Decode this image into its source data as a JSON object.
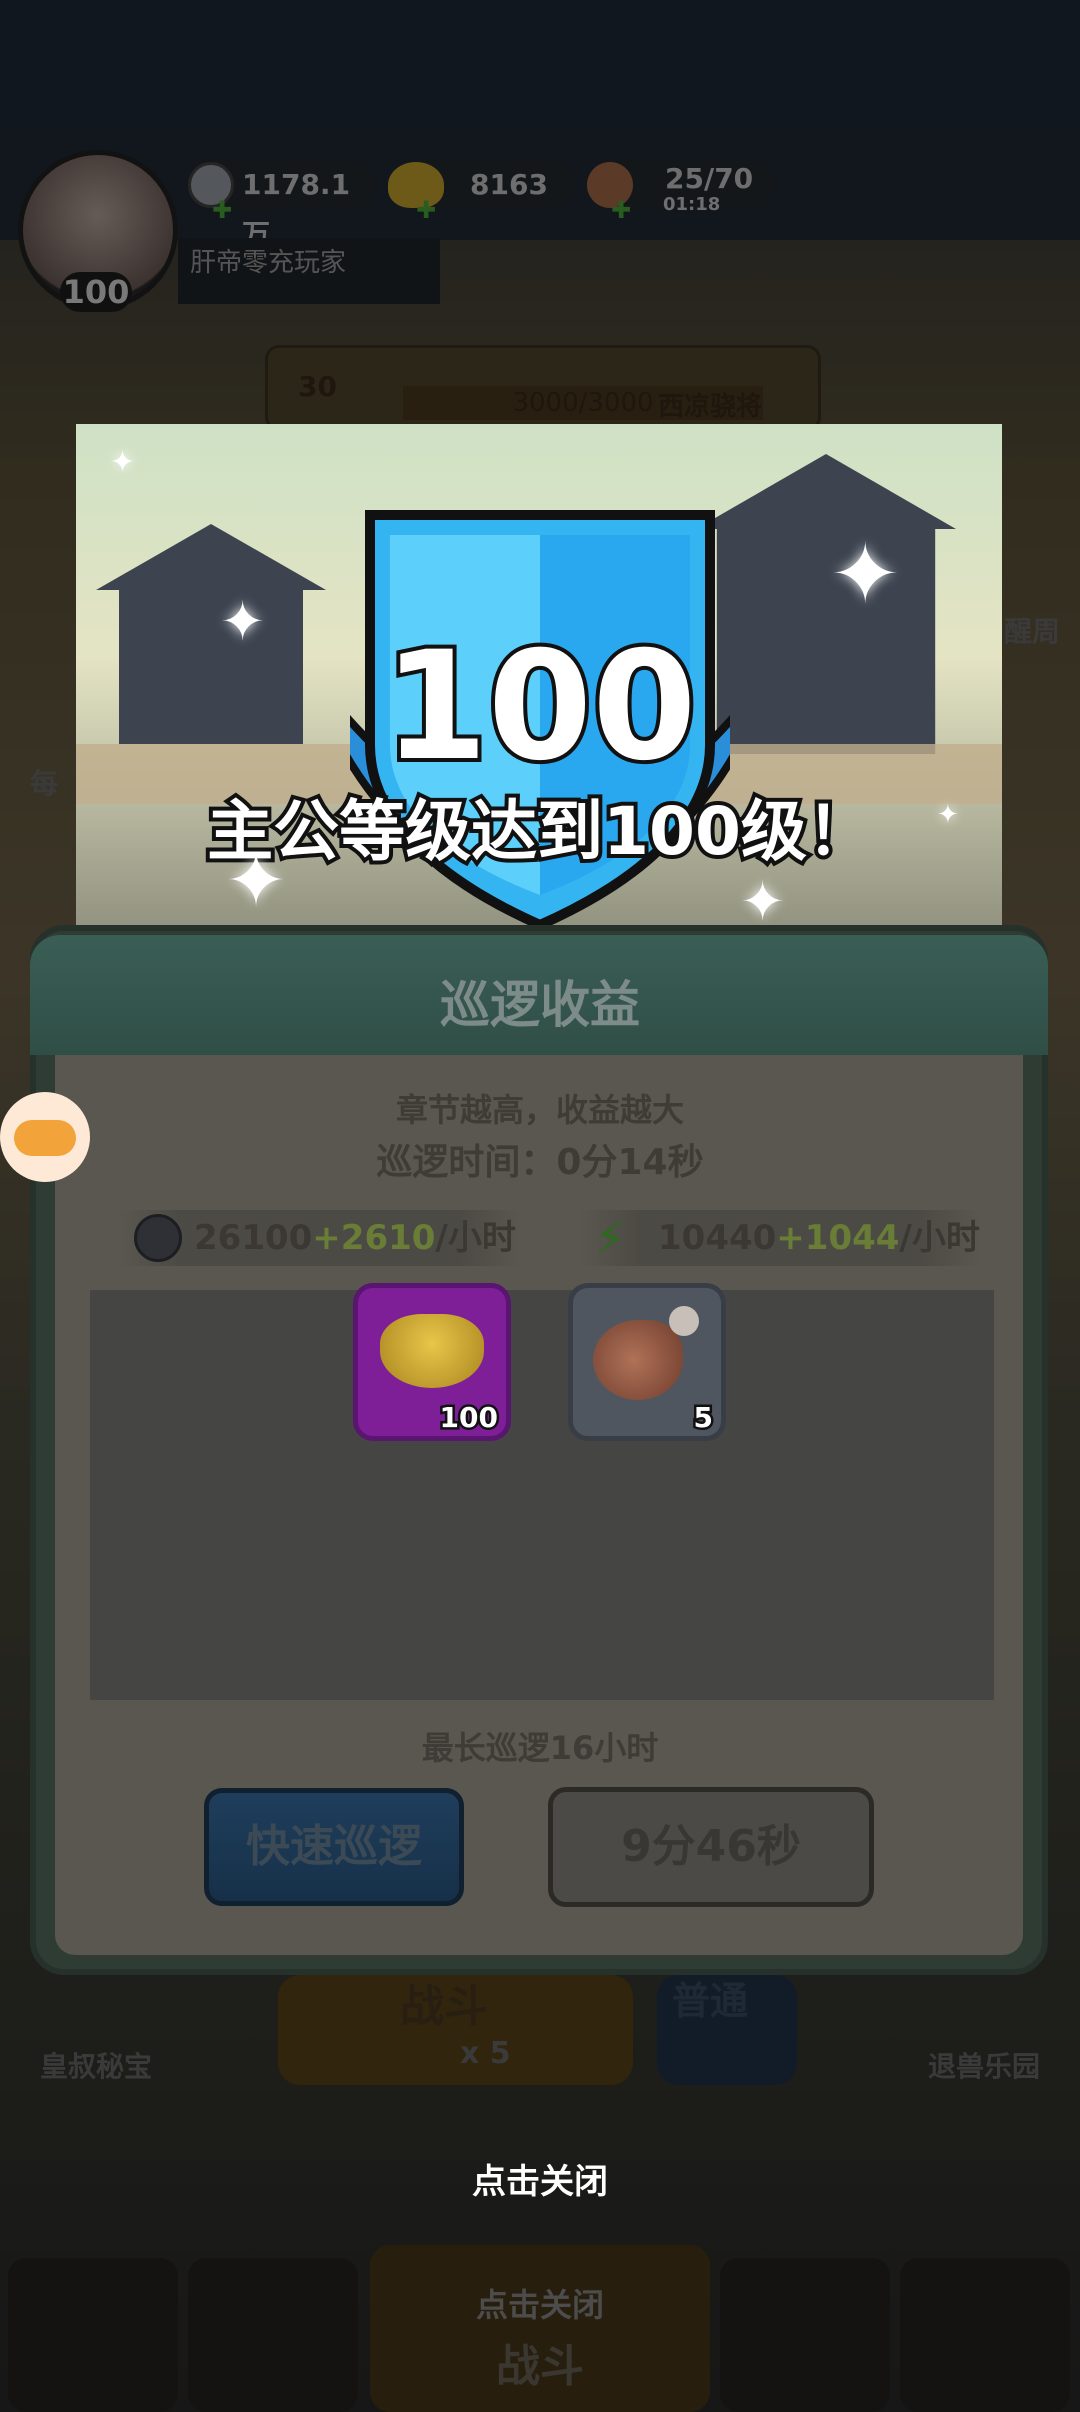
{
  "resources": {
    "silver": "1178.1万",
    "gold": "8163",
    "stamina": "25/70",
    "stamina_timer": "01:18"
  },
  "player": {
    "level": "100",
    "name": "肝帝零充玩家"
  },
  "stage": {
    "number": "30",
    "progress": "3000/3000",
    "name": "西凉骁将"
  },
  "levelup": {
    "level": "100",
    "message": "主公等级达到100级！"
  },
  "patrol": {
    "title": "巡逻收益",
    "subtitle": "章节越高，收益越大",
    "time_label": "巡逻时间：0分14秒",
    "silver_rate": {
      "base": "26100",
      "bonus": "+2610",
      "unit": "/小时"
    },
    "exp_rate": {
      "base": "10440",
      "bonus": "+1044",
      "unit": "/小时"
    },
    "rewards": [
      {
        "icon": "gold-ingot-icon",
        "count": "100",
        "rarity_color": "#b836d8"
      },
      {
        "icon": "meat-drumstick-icon",
        "count": "5",
        "rarity_color": "#8f9aa8"
      }
    ],
    "max_note": "最长巡逻16小时",
    "quick_button": "快速巡逻",
    "timer_button": "9分46秒"
  },
  "background": {
    "left_feature": "皇叔秘宝",
    "right_feature": "退兽乐园",
    "battle_button": "战斗",
    "battle_cost": "x 5",
    "pass_button": "普通",
    "side_left": "每",
    "side_right": "醒周",
    "bottom_close_hint": "点击关闭"
  },
  "close_hint": "点击关闭",
  "colors": {
    "accent_blue": "#29a8f0",
    "panel_teal": "#3a5e55",
    "plus_green": "#6a7d36"
  }
}
